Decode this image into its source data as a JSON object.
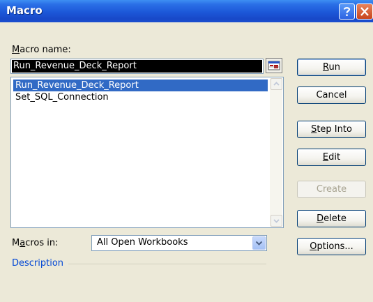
{
  "window": {
    "title": "Macro"
  },
  "macro_name": {
    "label_prefix": "",
    "label_underlined": "M",
    "label_rest": "acro name:",
    "value": "Run_Revenue_Deck_Report"
  },
  "macro_list": {
    "items": [
      {
        "label": "Run_Revenue_Deck_Report",
        "selected": true
      },
      {
        "label": "Set_SQL_Connection",
        "selected": false
      }
    ]
  },
  "buttons": {
    "run": {
      "pre": "",
      "ul": "R",
      "post": "un"
    },
    "cancel": {
      "pre": "Cancel",
      "ul": "",
      "post": ""
    },
    "step_into": {
      "pre": "",
      "ul": "S",
      "post": "tep Into"
    },
    "edit": {
      "pre": "",
      "ul": "E",
      "post": "dit"
    },
    "create": {
      "pre": "Create",
      "ul": "",
      "post": ""
    },
    "delete": {
      "pre": "",
      "ul": "D",
      "post": "elete"
    },
    "options": {
      "pre": "",
      "ul": "O",
      "post": "ptions..."
    }
  },
  "macros_in": {
    "label_pre": "M",
    "label_ul": "a",
    "label_post": "cros in:",
    "selected": "All Open Workbooks"
  },
  "description": {
    "label": "Description"
  },
  "colors": {
    "selection": "#316ac5",
    "titlebar": "#1c57d8",
    "description_label": "#0046d5"
  }
}
